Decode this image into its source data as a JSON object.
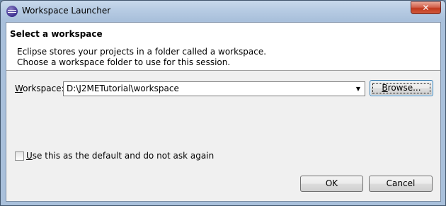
{
  "window": {
    "title": "Workspace Launcher",
    "close_symbol": "✕"
  },
  "header": {
    "title": "Select a workspace",
    "desc_line1": "Eclipse stores your projects in a folder called a workspace.",
    "desc_line2": "Choose a workspace folder to use for this session."
  },
  "workspace": {
    "label_mnemonic": "W",
    "label_rest": "orkspace:",
    "value": "D:\\J2METutorial\\workspace",
    "dropdown_symbol": "▼",
    "browse_mnemonic": "B",
    "browse_rest": "rowse..."
  },
  "options": {
    "default_checked": false,
    "default_label_mnemonic": "U",
    "default_label_rest": "se this as the default and do not ask again"
  },
  "buttons": {
    "ok": "OK",
    "cancel": "Cancel"
  },
  "icons": [
    "eclipse-logo-icon",
    "close-icon",
    "dropdown-arrow-icon",
    "checkbox-icon"
  ]
}
